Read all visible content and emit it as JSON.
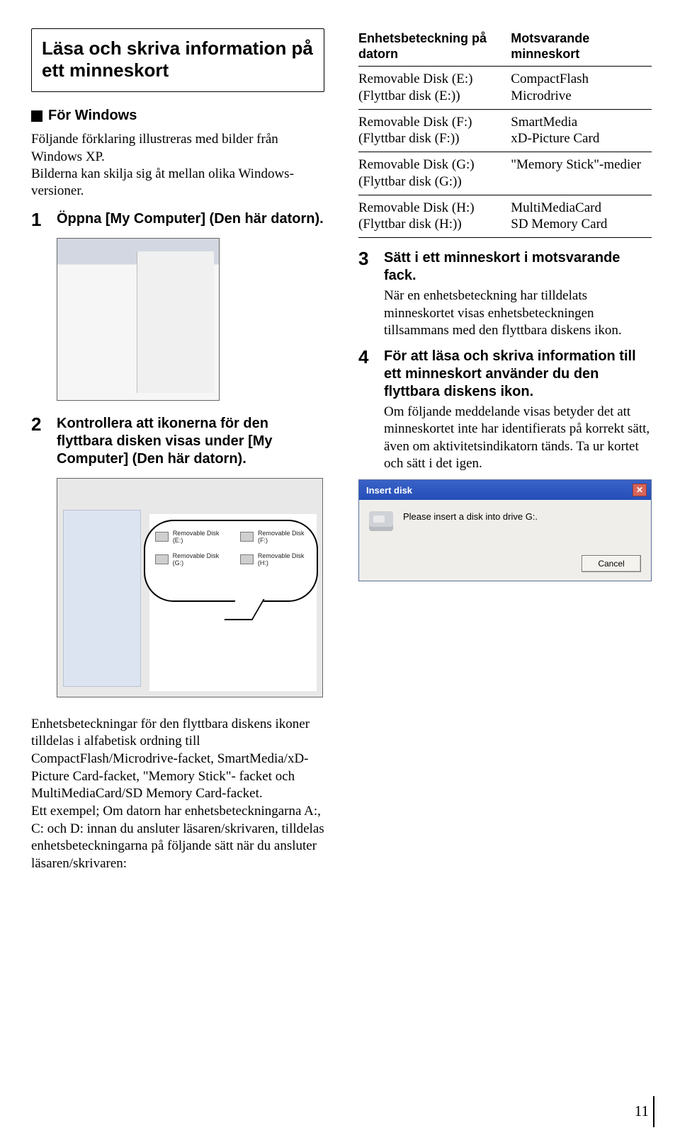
{
  "title": "Läsa och skriva information på ett minneskort",
  "subhead": "För Windows",
  "intro": "Följande förklaring illustreras med bilder från Windows XP.\nBilderna kan skilja sig åt mellan olika Windows-versioner.",
  "steps_left": {
    "s1": {
      "num": "1",
      "title": "Öppna [My Computer] (Den här datorn)."
    },
    "s2": {
      "num": "2",
      "title": "Kontrollera att ikonerna för den flyttbara disken visas under [My Computer] (Den här datorn)."
    }
  },
  "bubble": {
    "e": "Removable Disk (E:)",
    "f": "Removable Disk (F:)",
    "g": "Removable Disk (G:)",
    "h": "Removable Disk (H:)"
  },
  "table": {
    "h1": "Enhetsbeteckning på datorn",
    "h2": "Motsvarande minneskort",
    "rows": [
      {
        "a": "Removable Disk (E:)\n(Flyttbar disk (E:))",
        "b": "CompactFlash\nMicrodrive"
      },
      {
        "a": "Removable Disk (F:)\n(Flyttbar disk (F:))",
        "b": "SmartMedia\nxD-Picture Card"
      },
      {
        "a": "Removable Disk (G:)\n(Flyttbar disk (G:))",
        "b": "\"Memory Stick\"-medier"
      },
      {
        "a": "Removable Disk (H:)\n(Flyttbar disk (H:))",
        "b": "MultiMediaCard\nSD Memory Card"
      }
    ]
  },
  "steps_right": {
    "s3": {
      "num": "3",
      "title": "Sätt i ett minneskort i motsvarande fack.",
      "text": "När en enhetsbeteckning har tilldelats minneskortet visas enhetsbeteckningen tillsammans med den flyttbara diskens ikon."
    },
    "s4": {
      "num": "4",
      "title": "För att läsa och skriva information till ett minneskort använder du den flyttbara diskens ikon.",
      "text": "Om följande meddelande visas betyder det att minneskortet inte har identifierats på korrekt sätt, även om aktivitetsindikatorn tänds. Ta ur kortet och sätt i det igen."
    }
  },
  "dialog": {
    "title": "Insert disk",
    "message": "Please insert a disk into drive G:.",
    "cancel": "Cancel"
  },
  "bottom": "Enhetsbeteckningar för den flyttbara diskens ikoner tilldelas i alfabetisk ordning till CompactFlash/Microdrive-facket, SmartMedia/xD-Picture Card-facket, \"Memory Stick\"- facket och MultiMediaCard/SD Memory Card-facket.\nEtt exempel; Om datorn har enhetsbeteckningarna A:, C: och D: innan du ansluter läsaren/skrivaren, tilldelas enhetsbeteckningarna på följande sätt när du ansluter läsaren/skrivaren:",
  "page": "11"
}
